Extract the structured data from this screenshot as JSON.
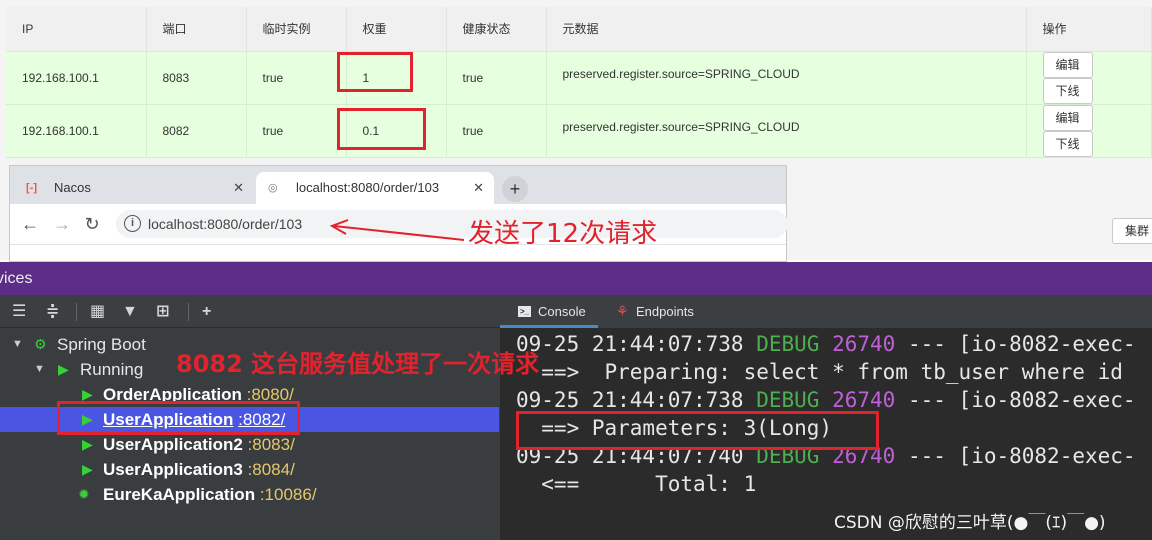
{
  "nacos": {
    "columns": [
      "IP",
      "端口",
      "临时实例",
      "权重",
      "健康状态",
      "元数据",
      "操作"
    ],
    "rows": [
      {
        "ip": "192.168.100.1",
        "port": "8083",
        "ephemeral": "true",
        "weight": "1",
        "healthy": "true",
        "metadata": "preserved.register.source=SPRING_CLOUD",
        "edit": "编辑",
        "offline": "下线"
      },
      {
        "ip": "192.168.100.1",
        "port": "8082",
        "ephemeral": "true",
        "weight": "0.1",
        "healthy": "true",
        "metadata": "preserved.register.source=SPRING_CLOUD",
        "edit": "编辑",
        "offline": "下线"
      }
    ],
    "cluster_button": "集群"
  },
  "browser": {
    "tabs": [
      {
        "label": "Nacos",
        "close": "✕"
      },
      {
        "label": "localhost:8080/order/103",
        "close": "✕"
      }
    ],
    "new_tab": "+",
    "url": "localhost:8080/order/103",
    "annotation": "发送了12次请求"
  },
  "services": {
    "title": "vices",
    "tree": {
      "root": "Spring Boot",
      "group": "Running",
      "apps": [
        {
          "name": "OrderApplication",
          "port": ":8080/"
        },
        {
          "name": "UserApplication",
          "port": ":8082/"
        },
        {
          "name": "UserApplication2",
          "port": ":8083/"
        },
        {
          "name": "UserApplication3",
          "port": ":8084/"
        },
        {
          "name": "EureKaApplication",
          "port": ":10086/"
        }
      ]
    },
    "annotation": "8082  这台服务值处理了一次请求",
    "console": {
      "tabs": [
        "Console",
        "Endpoints"
      ],
      "lines": [
        {
          "time": "09-25 21:44:07:738",
          "level": "DEBUG",
          "pid": "26740",
          "rest": "--- [io-8082-exec-"
        },
        {
          "text": "  ==>  Preparing: select * from tb_user where id"
        },
        {
          "time": "09-25 21:44:07:738",
          "level": "DEBUG",
          "pid": "26740",
          "rest": "--- [io-8082-exec-"
        },
        {
          "text": "  ==> Parameters: 3(Long)"
        },
        {
          "time": "09-25 21:44:07:740",
          "level": "DEBUG",
          "pid": "26740",
          "rest": "--- [io-8082-exec-"
        },
        {
          "text": "  <==      Total: 1"
        }
      ]
    }
  },
  "watermark": "CSDN @欣慰的三叶草(●￣(ｴ)￣●)",
  "colors": {
    "highlight": "#e0232d",
    "row_bg": "#e6ffdf",
    "title_bar": "#5b2d86",
    "selection": "#4a56e2"
  }
}
